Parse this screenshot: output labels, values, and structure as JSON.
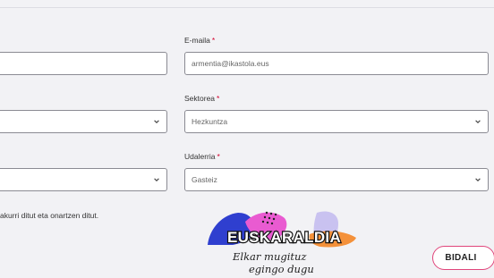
{
  "form": {
    "email": {
      "label": "E-maila",
      "required_mark": "*",
      "value": "armentia@ikastola.eus"
    },
    "sector": {
      "label": "Sektorea",
      "required_mark": "*",
      "value": "Hezkuntza"
    },
    "municipality": {
      "label": "Udalerria",
      "required_mark": "*",
      "value": "Gasteiz"
    },
    "left_input": {
      "value": ""
    },
    "left_select_1": {
      "value": ""
    },
    "left_select_2": {
      "value": ""
    },
    "consent_text": "akurri ditut eta onartzen ditut.",
    "submit_label": "BIDALI"
  },
  "logo": {
    "wordmark": "EUSKARALDIA",
    "tagline_line1": "Elkar mugituz",
    "tagline_line2": "egingo dugu"
  },
  "colors": {
    "required": "#d3002d",
    "button_border": "#e0457b",
    "logo_blue": "#2f3fcf",
    "logo_pink": "#e95bd1",
    "logo_orange": "#f4913a",
    "logo_lavender": "#c9c2f0"
  },
  "icons": {
    "select_arrow": "chevron-down-icon"
  }
}
